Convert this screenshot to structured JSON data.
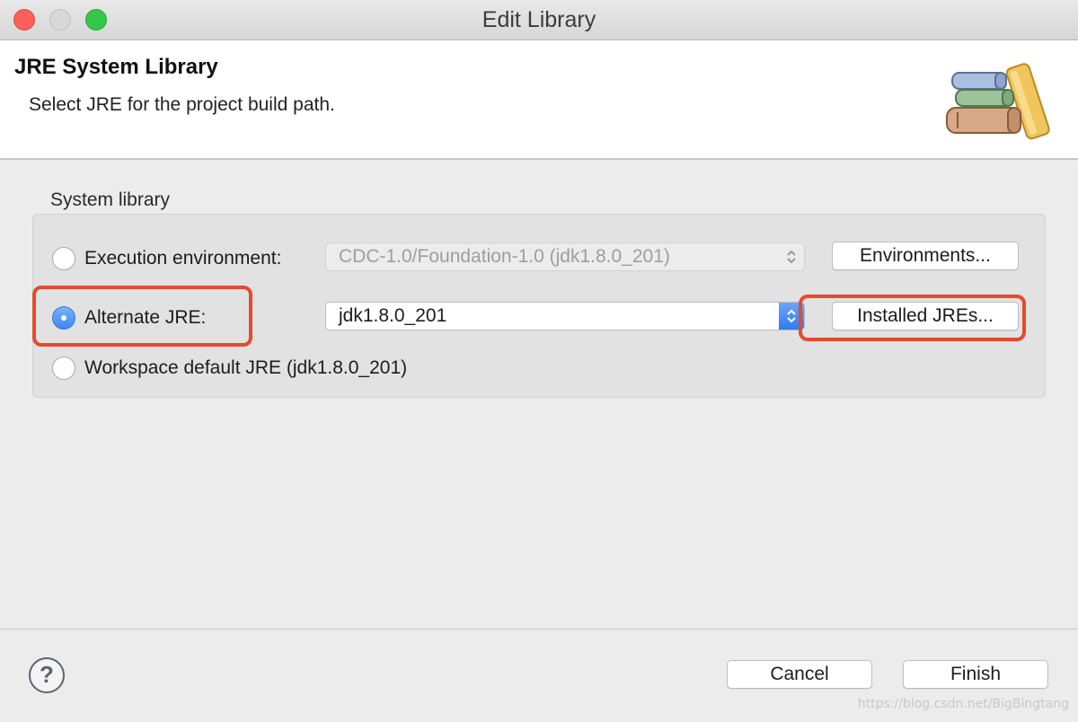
{
  "window": {
    "title": "Edit Library"
  },
  "header": {
    "title": "JRE System Library",
    "description": "Select JRE for the project build path."
  },
  "system_library": {
    "label": "System library",
    "options": [
      {
        "label": "Execution environment:",
        "selected": false
      },
      {
        "label": "Alternate JRE:",
        "selected": true
      },
      {
        "label": "Workspace default JRE (jdk1.8.0_201)",
        "selected": false
      }
    ],
    "execution_env_value": "CDC-1.0/Foundation-1.0 (jdk1.8.0_201)",
    "alternate_jre_value": "jdk1.8.0_201",
    "environments_button": "Environments...",
    "installed_jres_button": "Installed JREs..."
  },
  "footer": {
    "help_glyph": "?",
    "cancel": "Cancel",
    "finish": "Finish"
  },
  "watermark": "https://blog.csdn.net/BigBingtang",
  "colors": {
    "highlight": "#e64a2e",
    "radio_selected": "#3f86f4",
    "close": "#fc605c",
    "maximize": "#34c84a"
  }
}
